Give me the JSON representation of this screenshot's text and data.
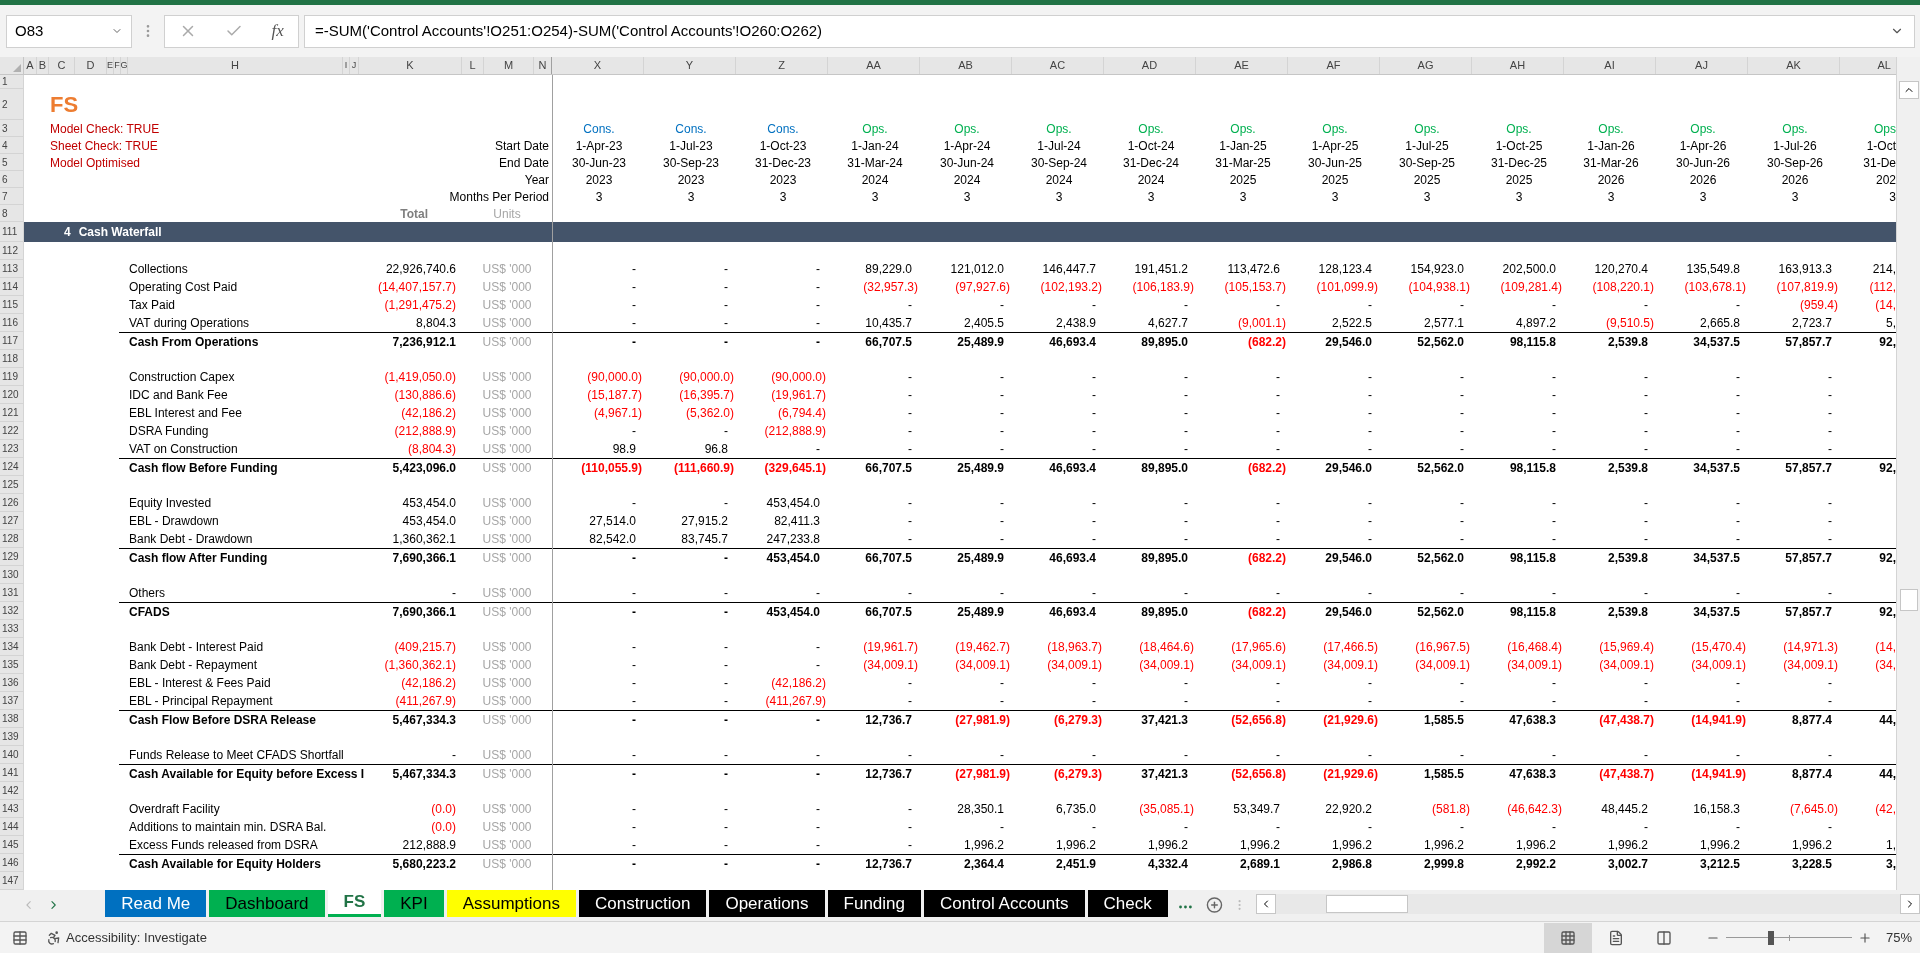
{
  "name_box": "O83",
  "function_label": "fx",
  "formula": "=-SUM('Control Accounts'!O251:O254)-SUM('Control Accounts'!O260:O262)",
  "frozen_columns": [
    "A",
    "B",
    "C",
    "D",
    "E",
    "F",
    "G",
    "H",
    "I",
    "J",
    "K",
    "L",
    "M",
    "N"
  ],
  "columns": [
    "X",
    "Y",
    "Z",
    "AA",
    "AB",
    "AC",
    "AD",
    "AE",
    "AF",
    "AG",
    "AH",
    "AI",
    "AJ",
    "AK",
    "AL"
  ],
  "rows": [
    {
      "kind": "blank",
      "number": "1"
    },
    {
      "kind": "title",
      "number": "2",
      "text": "FS"
    },
    {
      "kind": "phase",
      "number": "3",
      "note": "Model Check: TRUE",
      "cells": [
        {
          "text": "Cons.",
          "color": "#0070c0"
        },
        {
          "text": "Cons.",
          "color": "#0070c0"
        },
        {
          "text": "Cons.",
          "color": "#0070c0"
        },
        {
          "text": "Ops.",
          "color": "#00b050"
        },
        {
          "text": "Ops.",
          "color": "#00b050"
        },
        {
          "text": "Ops.",
          "color": "#00b050"
        },
        {
          "text": "Ops.",
          "color": "#00b050"
        },
        {
          "text": "Ops.",
          "color": "#00b050"
        },
        {
          "text": "Ops.",
          "color": "#00b050"
        },
        {
          "text": "Ops.",
          "color": "#00b050"
        },
        {
          "text": "Ops.",
          "color": "#00b050"
        },
        {
          "text": "Ops.",
          "color": "#00b050"
        },
        {
          "text": "Ops.",
          "color": "#00b050"
        },
        {
          "text": "Ops.",
          "color": "#00b050"
        },
        {
          "text": "Ops",
          "color": "#00b050"
        }
      ]
    },
    {
      "kind": "header",
      "number": "4",
      "note": "Sheet Check: TRUE",
      "label": "Start Date",
      "cells": [
        "1-Apr-23",
        "1-Jul-23",
        "1-Oct-23",
        "1-Jan-24",
        "1-Apr-24",
        "1-Jul-24",
        "1-Oct-24",
        "1-Jan-25",
        "1-Apr-25",
        "1-Jul-25",
        "1-Oct-25",
        "1-Jan-26",
        "1-Apr-26",
        "1-Jul-26",
        "1-Oct"
      ]
    },
    {
      "kind": "header",
      "number": "5",
      "note": "Model Optimised",
      "label": "End Date",
      "cells": [
        "30-Jun-23",
        "30-Sep-23",
        "31-Dec-23",
        "31-Mar-24",
        "30-Jun-24",
        "30-Sep-24",
        "31-Dec-24",
        "31-Mar-25",
        "30-Jun-25",
        "30-Sep-25",
        "31-Dec-25",
        "31-Mar-26",
        "30-Jun-26",
        "30-Sep-26",
        "31-De"
      ]
    },
    {
      "kind": "header",
      "number": "6",
      "label": "Year",
      "cells": [
        "2023",
        "2023",
        "2023",
        "2024",
        "2024",
        "2024",
        "2024",
        "2025",
        "2025",
        "2025",
        "2025",
        "2026",
        "2026",
        "2026",
        "202"
      ]
    },
    {
      "kind": "header",
      "number": "7",
      "label": "Months Per Period",
      "cells": [
        "3",
        "3",
        "3",
        "3",
        "3",
        "3",
        "3",
        "3",
        "3",
        "3",
        "3",
        "3",
        "3",
        "3",
        "3"
      ]
    },
    {
      "kind": "captions",
      "number": "8",
      "total": "Total",
      "units": "Units"
    },
    {
      "kind": "section",
      "number": "111",
      "index": "4",
      "text": "Cash Waterfall"
    },
    {
      "kind": "blank",
      "number": "112"
    },
    {
      "kind": "line",
      "number": "113",
      "label": "Collections",
      "total": "22,926,740.6",
      "units": "US$ '000",
      "values": [
        "-",
        "-",
        "-",
        "89,229.0",
        "121,012.0",
        "146,447.7",
        "191,451.2",
        "113,472.6",
        "128,123.4",
        "154,923.0",
        "202,500.0",
        "120,270.4",
        "135,549.8",
        "163,913.3",
        "214,"
      ]
    },
    {
      "kind": "line",
      "number": "114",
      "label": "Operating Cost Paid",
      "total": "(14,407,157.7)",
      "units": "US$ '000",
      "values": [
        "-",
        "-",
        "-",
        "(32,957.3)",
        "(97,927.6)",
        "(102,193.2)",
        "(106,183.9)",
        "(105,153.7)",
        "(101,099.9)",
        "(104,938.1)",
        "(109,281.4)",
        "(108,220.1)",
        "(103,678.1)",
        "(107,819.9)",
        "(112,"
      ]
    },
    {
      "kind": "line",
      "number": "115",
      "label": "Tax Paid",
      "total": "(1,291,475.2)",
      "units": "US$ '000",
      "values": [
        "-",
        "-",
        "-",
        "-",
        "-",
        "-",
        "-",
        "-",
        "-",
        "-",
        "-",
        "-",
        "-",
        "(959.4)",
        "(14,"
      ]
    },
    {
      "kind": "line",
      "number": "116",
      "label": "VAT during Operations",
      "total": "8,804.3",
      "units": "US$ '000",
      "values": [
        "-",
        "-",
        "-",
        "10,435.7",
        "2,405.5",
        "2,438.9",
        "4,627.7",
        "(9,001.1)",
        "2,522.5",
        "2,577.1",
        "4,897.2",
        "(9,510.5)",
        "2,665.8",
        "2,723.7",
        "5,"
      ]
    },
    {
      "kind": "subtotal",
      "number": "117",
      "label": "Cash From Operations",
      "total": "7,236,912.1",
      "units": "US$ '000",
      "values": [
        "-",
        "-",
        "-",
        "66,707.5",
        "25,489.9",
        "46,693.4",
        "89,895.0",
        "(682.2)",
        "29,546.0",
        "52,562.0",
        "98,115.8",
        "2,539.8",
        "34,537.5",
        "57,857.7",
        "92,"
      ]
    },
    {
      "kind": "blank",
      "number": "118"
    },
    {
      "kind": "line",
      "number": "119",
      "label": "Construction Capex",
      "total": "(1,419,050.0)",
      "units": "US$ '000",
      "values": [
        "(90,000.0)",
        "(90,000.0)",
        "(90,000.0)",
        "-",
        "-",
        "-",
        "-",
        "-",
        "-",
        "-",
        "-",
        "-",
        "-",
        "-"
      ]
    },
    {
      "kind": "line",
      "number": "120",
      "label": "IDC and Bank Fee",
      "total": "(130,886.6)",
      "units": "US$ '000",
      "values": [
        "(15,187.7)",
        "(16,395.7)",
        "(19,961.7)",
        "-",
        "-",
        "-",
        "-",
        "-",
        "-",
        "-",
        "-",
        "-",
        "-",
        "-"
      ]
    },
    {
      "kind": "line",
      "number": "121",
      "label": "EBL Interest and Fee",
      "total": "(42,186.2)",
      "units": "US$ '000",
      "values": [
        "(4,967.1)",
        "(5,362.0)",
        "(6,794.4)",
        "-",
        "-",
        "-",
        "-",
        "-",
        "-",
        "-",
        "-",
        "-",
        "-",
        "-"
      ]
    },
    {
      "kind": "line",
      "number": "122",
      "label": "DSRA Funding",
      "total": "(212,888.9)",
      "units": "US$ '000",
      "values": [
        "-",
        "-",
        "(212,888.9)",
        "-",
        "-",
        "-",
        "-",
        "-",
        "-",
        "-",
        "-",
        "-",
        "-",
        "-"
      ]
    },
    {
      "kind": "line",
      "number": "123",
      "label": "VAT on Construction",
      "total": "(8,804.3)",
      "units": "US$ '000",
      "values": [
        "98.9",
        "96.8",
        "-",
        "-",
        "-",
        "-",
        "-",
        "-",
        "-",
        "-",
        "-",
        "-",
        "-",
        "-"
      ]
    },
    {
      "kind": "subtotal",
      "number": "124",
      "label": "Cash flow Before Funding",
      "total": "5,423,096.0",
      "units": "US$ '000",
      "values": [
        "(110,055.9)",
        "(111,660.9)",
        "(329,645.1)",
        "66,707.5",
        "25,489.9",
        "46,693.4",
        "89,895.0",
        "(682.2)",
        "29,546.0",
        "52,562.0",
        "98,115.8",
        "2,539.8",
        "34,537.5",
        "57,857.7",
        "92,"
      ]
    },
    {
      "kind": "blank",
      "number": "125"
    },
    {
      "kind": "line",
      "number": "126",
      "label": "Equity Invested",
      "total": "453,454.0",
      "units": "US$ '000",
      "values": [
        "-",
        "-",
        "453,454.0",
        "-",
        "-",
        "-",
        "-",
        "-",
        "-",
        "-",
        "-",
        "-",
        "-",
        "-"
      ]
    },
    {
      "kind": "line",
      "number": "127",
      "label": "EBL - Drawdown",
      "total": "453,454.0",
      "units": "US$ '000",
      "values": [
        "27,514.0",
        "27,915.2",
        "82,411.3",
        "-",
        "-",
        "-",
        "-",
        "-",
        "-",
        "-",
        "-",
        "-",
        "-",
        "-"
      ]
    },
    {
      "kind": "line",
      "number": "128",
      "label": "Bank Debt - Drawdown",
      "total": "1,360,362.1",
      "units": "US$ '000",
      "values": [
        "82,542.0",
        "83,745.7",
        "247,233.8",
        "-",
        "-",
        "-",
        "-",
        "-",
        "-",
        "-",
        "-",
        "-",
        "-",
        "-"
      ]
    },
    {
      "kind": "subtotal",
      "number": "129",
      "label": "Cash flow After Funding",
      "total": "7,690,366.1",
      "units": "US$ '000",
      "values": [
        "-",
        "-",
        "453,454.0",
        "66,707.5",
        "25,489.9",
        "46,693.4",
        "89,895.0",
        "(682.2)",
        "29,546.0",
        "52,562.0",
        "98,115.8",
        "2,539.8",
        "34,537.5",
        "57,857.7",
        "92,"
      ]
    },
    {
      "kind": "blank",
      "number": "130"
    },
    {
      "kind": "line",
      "number": "131",
      "label": "Others",
      "total": "-",
      "units": "US$ '000",
      "values": [
        "-",
        "-",
        "-",
        "-",
        "-",
        "-",
        "-",
        "-",
        "-",
        "-",
        "-",
        "-",
        "-",
        "-"
      ]
    },
    {
      "kind": "subtotal",
      "number": "132",
      "label": "CFADS",
      "total": "7,690,366.1",
      "units": "US$ '000",
      "values": [
        "-",
        "-",
        "453,454.0",
        "66,707.5",
        "25,489.9",
        "46,693.4",
        "89,895.0",
        "(682.2)",
        "29,546.0",
        "52,562.0",
        "98,115.8",
        "2,539.8",
        "34,537.5",
        "57,857.7",
        "92,"
      ]
    },
    {
      "kind": "blank",
      "number": "133"
    },
    {
      "kind": "line",
      "number": "134",
      "label": "Bank Debt - Interest Paid",
      "total": "(409,215.7)",
      "units": "US$ '000",
      "values": [
        "-",
        "-",
        "-",
        "(19,961.7)",
        "(19,462.7)",
        "(18,963.7)",
        "(18,464.6)",
        "(17,965.6)",
        "(17,466.5)",
        "(16,967.5)",
        "(16,468.4)",
        "(15,969.4)",
        "(15,470.4)",
        "(14,971.3)",
        "(14,"
      ]
    },
    {
      "kind": "line",
      "number": "135",
      "label": "Bank Debt - Repayment",
      "total": "(1,360,362.1)",
      "units": "US$ '000",
      "values": [
        "-",
        "-",
        "-",
        "(34,009.1)",
        "(34,009.1)",
        "(34,009.1)",
        "(34,009.1)",
        "(34,009.1)",
        "(34,009.1)",
        "(34,009.1)",
        "(34,009.1)",
        "(34,009.1)",
        "(34,009.1)",
        "(34,009.1)",
        "(34,"
      ]
    },
    {
      "kind": "line",
      "number": "136",
      "label": "EBL - Interest & Fees Paid",
      "total": "(42,186.2)",
      "units": "US$ '000",
      "values": [
        "-",
        "-",
        "(42,186.2)",
        "-",
        "-",
        "-",
        "-",
        "-",
        "-",
        "-",
        "-",
        "-",
        "-",
        "-"
      ]
    },
    {
      "kind": "line",
      "number": "137",
      "label": "EBL - Principal Repayment",
      "total": "(411,267.9)",
      "units": "US$ '000",
      "values": [
        "-",
        "-",
        "(411,267.9)",
        "-",
        "-",
        "-",
        "-",
        "-",
        "-",
        "-",
        "-",
        "-",
        "-",
        "-"
      ]
    },
    {
      "kind": "subtotal",
      "number": "138",
      "label": "Cash Flow Before DSRA Release",
      "total": "5,467,334.3",
      "units": "US$ '000",
      "values": [
        "-",
        "-",
        "-",
        "12,736.7",
        "(27,981.9)",
        "(6,279.3)",
        "37,421.3",
        "(52,656.8)",
        "(21,929.6)",
        "1,585.5",
        "47,638.3",
        "(47,438.7)",
        "(14,941.9)",
        "8,877.4",
        "44,"
      ]
    },
    {
      "kind": "blank",
      "number": "139"
    },
    {
      "kind": "line",
      "number": "140",
      "label": "Funds Release to Meet CFADS Shortfall",
      "total": "-",
      "units": "US$ '000",
      "values": [
        "-",
        "-",
        "-",
        "-",
        "-",
        "-",
        "-",
        "-",
        "-",
        "-",
        "-",
        "-",
        "-",
        "-"
      ]
    },
    {
      "kind": "subtotal",
      "number": "141",
      "label": "Cash Available for Equity before Excess I",
      "total": "5,467,334.3",
      "units": "US$ '000",
      "values": [
        "-",
        "-",
        "-",
        "12,736.7",
        "(27,981.9)",
        "(6,279.3)",
        "37,421.3",
        "(52,656.8)",
        "(21,929.6)",
        "1,585.5",
        "47,638.3",
        "(47,438.7)",
        "(14,941.9)",
        "8,877.4",
        "44,"
      ]
    },
    {
      "kind": "blank",
      "number": "142"
    },
    {
      "kind": "line",
      "number": "143",
      "label": "Overdraft Facility",
      "total": "(0.0)",
      "units": "US$ '000",
      "values": [
        "-",
        "-",
        "-",
        "-",
        "28,350.1",
        "6,735.0",
        "(35,085.1)",
        "53,349.7",
        "22,920.2",
        "(581.8)",
        "(46,642.3)",
        "48,445.2",
        "16,158.3",
        "(7,645.0)",
        "(42,"
      ]
    },
    {
      "kind": "line",
      "number": "144",
      "label": "Additions to maintain min. DSRA Bal.",
      "total": "(0.0)",
      "units": "US$ '000",
      "values": [
        "-",
        "-",
        "-",
        "-",
        "-",
        "-",
        "-",
        "-",
        "-",
        "-",
        "-",
        "-",
        "-",
        "-"
      ]
    },
    {
      "kind": "line",
      "number": "145",
      "label": "Excess Funds released from DSRA",
      "total": "212,888.9",
      "units": "US$ '000",
      "values": [
        "-",
        "-",
        "-",
        "-",
        "1,996.2",
        "1,996.2",
        "1,996.2",
        "1,996.2",
        "1,996.2",
        "1,996.2",
        "1,996.2",
        "1,996.2",
        "1,996.2",
        "1,996.2",
        "1,"
      ]
    },
    {
      "kind": "subtotal",
      "number": "146",
      "label": "Cash Available for Equity Holders",
      "total": "5,680,223.2",
      "units": "US$ '000",
      "values": [
        "-",
        "-",
        "-",
        "12,736.7",
        "2,364.4",
        "2,451.9",
        "4,332.4",
        "2,689.1",
        "2,986.8",
        "2,999.8",
        "2,992.2",
        "3,002.7",
        "3,212.5",
        "3,228.5",
        "3,"
      ]
    },
    {
      "kind": "blank",
      "number": "147"
    }
  ],
  "sheet_tabs": [
    {
      "label": "Read Me",
      "color": "#0070c0",
      "selected": false
    },
    {
      "label": "Dashboard",
      "color": "#00b050",
      "selected": false
    },
    {
      "label": "FS",
      "color": "#00b050",
      "selected": true
    },
    {
      "label": "KPI",
      "color": "#00b050",
      "selected": false
    },
    {
      "label": "Assumptions",
      "color": "#ffff00",
      "selected": false
    },
    {
      "label": "Construction",
      "color": "#000000",
      "selected": false
    },
    {
      "label": "Operations",
      "color": "#000000",
      "selected": false
    },
    {
      "label": "Funding",
      "color": "#000000",
      "selected": false
    },
    {
      "label": "Control Accounts",
      "color": "#000000",
      "selected": false
    },
    {
      "label": "Check",
      "color": "#000000",
      "selected": false
    }
  ],
  "status_bar": {
    "accessibility": "Accessibility: Investigate",
    "views": [
      {
        "kind": "normal",
        "selected": true
      },
      {
        "kind": "page_layout",
        "selected": false
      },
      {
        "kind": "page_break",
        "selected": false
      }
    ],
    "zoom_slider": {
      "level": 0.36
    },
    "zoom": "75%"
  }
}
